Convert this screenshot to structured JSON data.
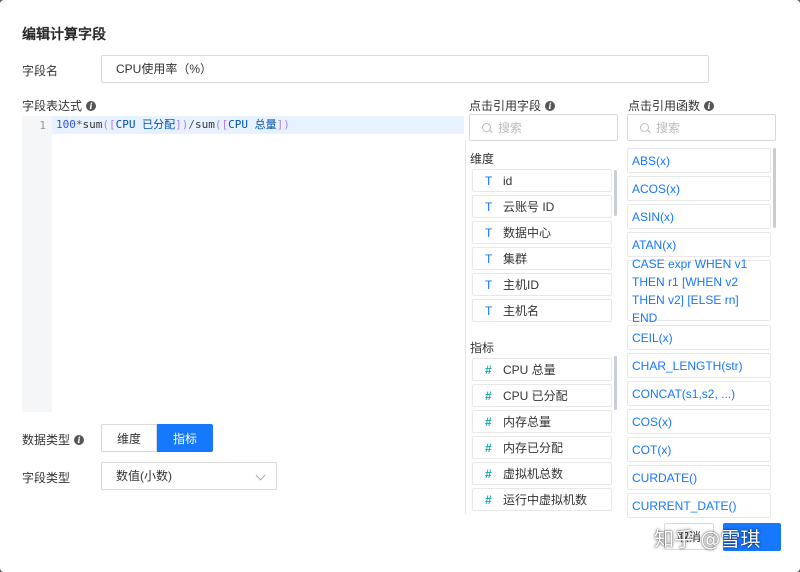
{
  "dialog": {
    "title": "编辑计算字段",
    "field_name_label": "字段名",
    "field_name_value": "CPU使用率（%）",
    "expression_label": "字段表达式",
    "data_type_label": "数据类型",
    "field_type_label": "字段类型"
  },
  "editor": {
    "line_number": "1",
    "tokens": {
      "num": "100",
      "op1": "*",
      "fn1": "sum",
      "br1": "([",
      "fld1": "CPU 已分配",
      "br2": "])",
      "op2": "/",
      "fn2": "sum",
      "br3": "([",
      "fld2": "CPU 总量",
      "br4": "])"
    }
  },
  "data_type": {
    "options": [
      "维度",
      "指标"
    ],
    "selected": "指标"
  },
  "field_type": {
    "value": "数值(小数)"
  },
  "fields_panel": {
    "title": "点击引用字段",
    "search_placeholder": "搜索",
    "dimension_title": "维度",
    "dimension_icon": "T",
    "dimensions": [
      "id",
      "云账号 ID",
      "数据中心",
      "集群",
      "主机ID",
      "主机名"
    ],
    "metric_title": "指标",
    "metric_icon": "#",
    "metrics": [
      "CPU 总量",
      "CPU 已分配",
      "内存总量",
      "内存已分配",
      "虚拟机总数",
      "运行中虚拟机数"
    ]
  },
  "functions_panel": {
    "title": "点击引用函数",
    "search_placeholder": "搜索",
    "functions": [
      "ABS(x)",
      "ACOS(x)",
      "ASIN(x)",
      "ATAN(x)",
      "CASE expr WHEN v1 THEN r1 [WHEN v2 THEN v2] [ELSE rn] END",
      "CEIL(x)",
      "CHAR_LENGTH(str)",
      "CONCAT(s1,s2, ...)",
      "COS(x)",
      "COT(x)",
      "CURDATE()",
      "CURRENT_DATE()"
    ]
  },
  "footer": {
    "cancel_label": "取消",
    "watermark": "知乎 @雪琪"
  },
  "colors": {
    "primary": "#1677ff",
    "metric_icon": "#13a8a8",
    "editor_highlight": "#e8f2ff"
  }
}
